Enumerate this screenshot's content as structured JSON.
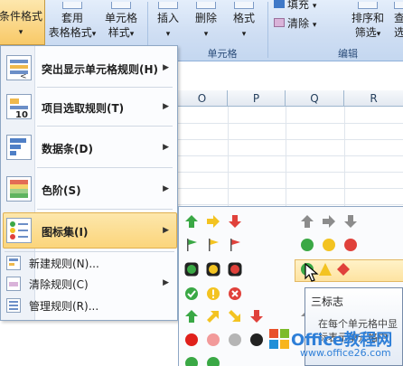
{
  "ribbon": {
    "buttons": {
      "conditional_format": "条件格式",
      "table_format_l1": "套用",
      "table_format_l2": "表格格式",
      "cell_style_l1": "单元格",
      "cell_style_l2": "样式",
      "insert": "插入",
      "delete": "删除",
      "format": "格式",
      "fill": "填充",
      "clear": "清除",
      "sort_l1": "排序和",
      "sort_l2": "筛选",
      "find_l1": "查",
      "find_l2": "选"
    },
    "groups": {
      "cells": "单元格",
      "editing": "编辑"
    },
    "dropdown_arrow": "▾"
  },
  "sheet": {
    "columns": [
      "O",
      "P",
      "Q",
      "R"
    ]
  },
  "menu": {
    "items": [
      {
        "label": "突出显示单元格规则(H)",
        "icon": "highlight-cells-icon"
      },
      {
        "label": "项目选取规则(T)",
        "icon": "top-bottom-icon"
      },
      {
        "label": "数据条(D)",
        "icon": "data-bars-icon"
      },
      {
        "label": "色阶(S)",
        "icon": "color-scales-icon"
      },
      {
        "label": "图标集(I)",
        "icon": "icon-sets-icon"
      }
    ],
    "small_items": [
      {
        "label": "新建规则(N)...",
        "icon": "new-rule-icon"
      },
      {
        "label": "清除规则(C)",
        "icon": "clear-rules-icon"
      },
      {
        "label": "管理规则(R)...",
        "icon": "manage-rules-icon"
      }
    ],
    "arrow": "▶"
  },
  "icon_gallery": {
    "sets": [
      "three-colored-arrows",
      "three-gray-arrows",
      "three-flags",
      "three-traffic-lights-circle",
      "three-traffic-lights-rimmed",
      "three-signs",
      "three-symbols-circled",
      "four-arrows",
      "four-red-to-black"
    ],
    "colors": {
      "green": "#3aa845",
      "yellow": "#f3c321",
      "red": "#e0413b",
      "gray": "#8c8c8c",
      "black": "#222222"
    }
  },
  "tooltip": {
    "title": "三标志",
    "body_l1": "在每个单元格中显",
    "body_l2": "标表示单元格中"
  },
  "watermark": {
    "title": "Office教程网",
    "url": "www.office26.com"
  }
}
